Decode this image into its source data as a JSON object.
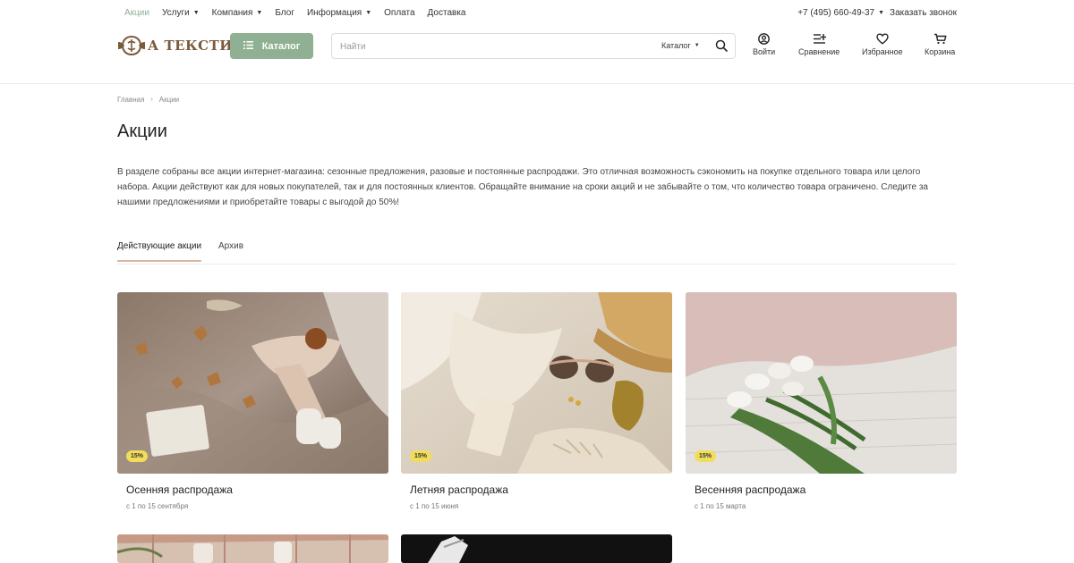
{
  "topnav": {
    "items": [
      {
        "label": "Акции",
        "active": true,
        "has_dropdown": false
      },
      {
        "label": "Услуги",
        "active": false,
        "has_dropdown": true
      },
      {
        "label": "Компания",
        "active": false,
        "has_dropdown": true
      },
      {
        "label": "Блог",
        "active": false,
        "has_dropdown": false
      },
      {
        "label": "Информация",
        "active": false,
        "has_dropdown": true
      },
      {
        "label": "Оплата",
        "active": false,
        "has_dropdown": false
      },
      {
        "label": "Доставка",
        "active": false,
        "has_dropdown": false
      }
    ],
    "phone": "+7 (495) 660-49-37",
    "callback": "Заказать звонок"
  },
  "header": {
    "logo_text": "А ТЕКСТИЛЬ",
    "catalog_label": "Каталог",
    "search": {
      "placeholder": "Найти",
      "scope": "Каталог"
    },
    "actions": [
      {
        "label": "Войти",
        "icon": "user-icon"
      },
      {
        "label": "Сравнение",
        "icon": "compare-icon"
      },
      {
        "label": "Избранное",
        "icon": "heart-icon"
      },
      {
        "label": "Корзина",
        "icon": "cart-icon"
      }
    ]
  },
  "breadcrumb": {
    "home": "Главная",
    "current": "Акции"
  },
  "page": {
    "title": "Акции",
    "intro": "В разделе собраны все акции интернет-магазина: сезонные предложения, разовые и постоянные распродажи. Это отличная возможность сэкономить на покупке отдельного товара или целого набора. Акции действуют как для новых покупателей, так и для постоянных клиентов. Обращайте внимание на сроки акций и не забывайте о том, что количество товара ограничено. Следите за нашими предложениями и приобретайте товары с выгодой до 50%!"
  },
  "tabs": [
    {
      "label": "Действующие акции",
      "active": true
    },
    {
      "label": "Архив",
      "active": false
    }
  ],
  "promos": [
    {
      "title": "Осенняя распродажа",
      "dates": "с 1 по 15 сентября",
      "badge": "15%"
    },
    {
      "title": "Летняя распродажа",
      "dates": "с 1 по 15 июня",
      "badge": "15%"
    },
    {
      "title": "Весенняя распродажа",
      "dates": "с 1 по 15 марта",
      "badge": "15%"
    },
    {
      "title": "",
      "dates": "",
      "badge": ""
    },
    {
      "title": "",
      "dates": "",
      "badge": ""
    }
  ],
  "colors": {
    "accent": "#8fb092",
    "badge": "#f2dd5b",
    "tab_underline": "#d9b9a4"
  }
}
